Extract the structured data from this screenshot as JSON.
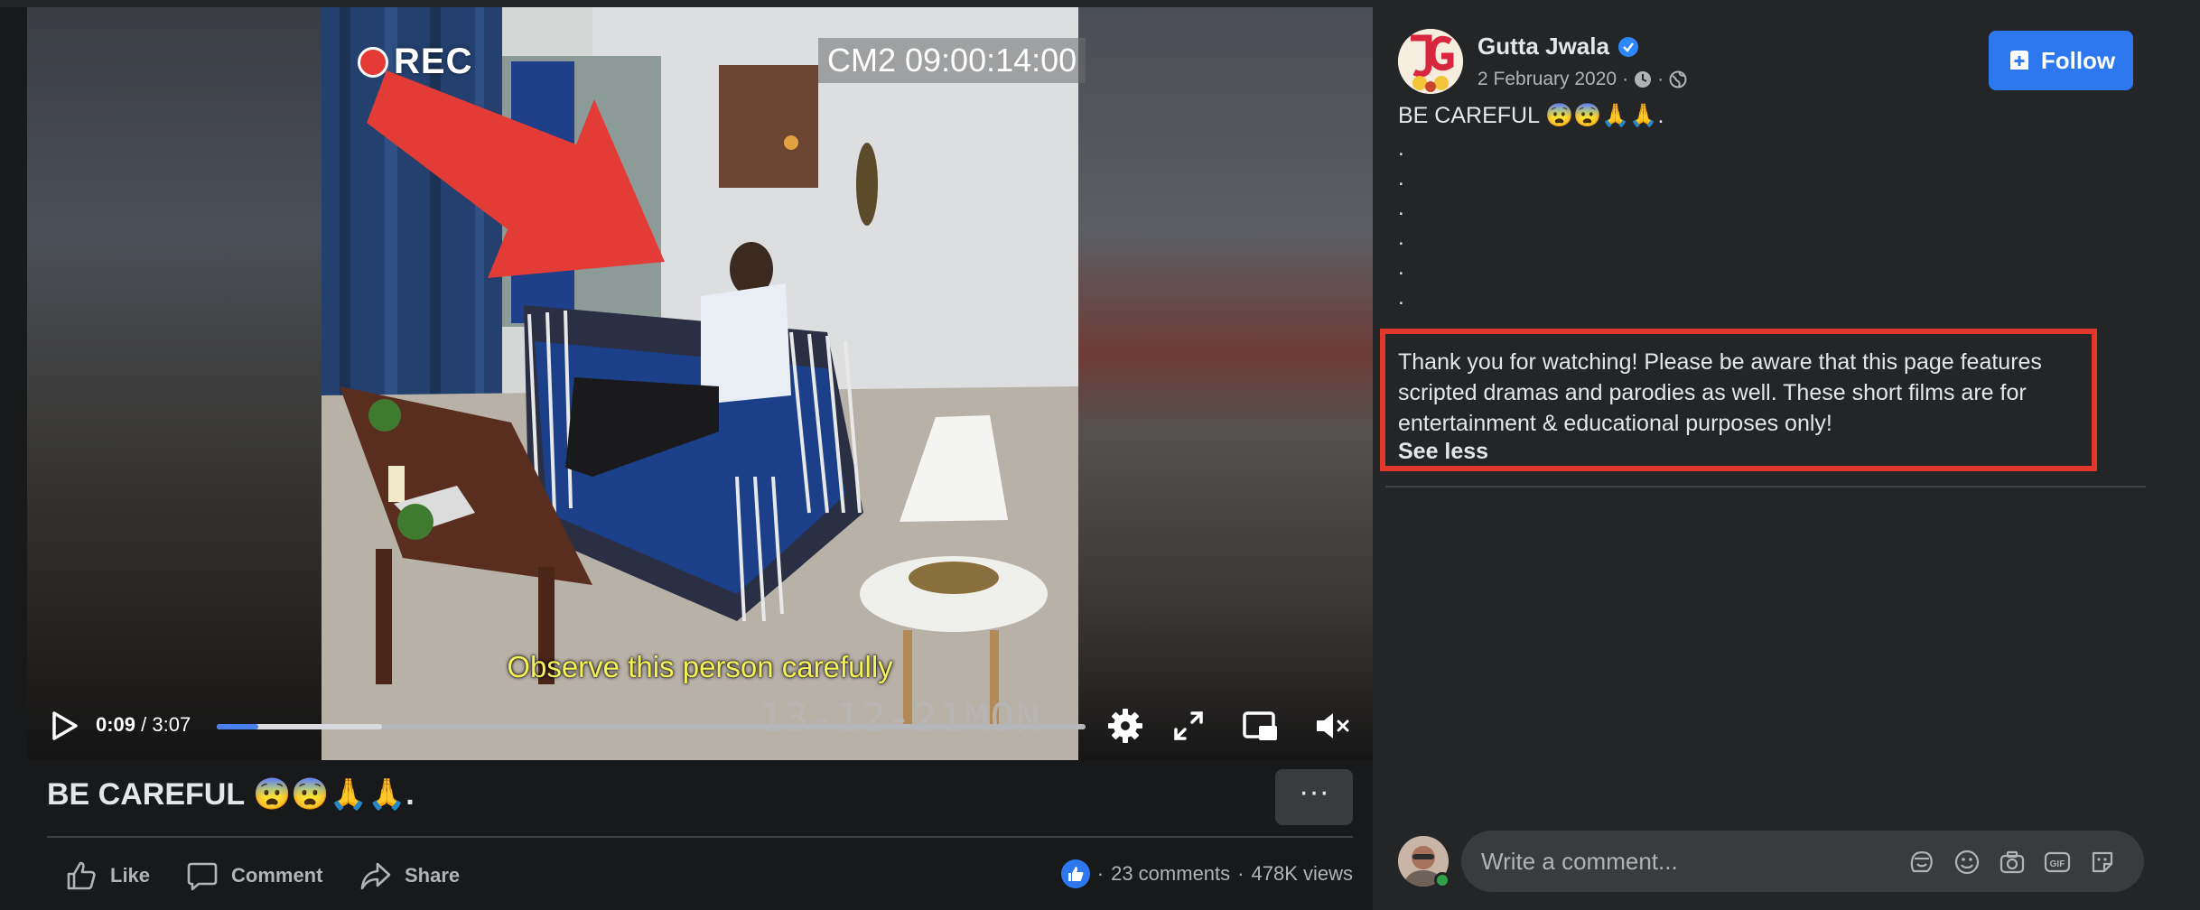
{
  "video": {
    "rec_label": "REC",
    "camera_stamp": "CM2 09:00:14:00",
    "subtitle": "Observe this person carefully",
    "date_stamp": "13-12-21MON",
    "current_time": "0:09",
    "duration": "3:07",
    "time_separator": "/",
    "progress_fraction": 0.048,
    "buffered_fraction": 0.19
  },
  "post": {
    "title": "BE CAREFUL 😨😨🙏🙏.",
    "more_label": "···",
    "actions": {
      "like": "Like",
      "comment": "Comment",
      "share": "Share"
    },
    "stats": {
      "comments": "23 comments",
      "views": "478K views",
      "sep": "·"
    }
  },
  "author": {
    "name": "Gutta Jwala",
    "date": "2 February 2020",
    "follow_label": "Follow",
    "meta_sep": "·"
  },
  "description": {
    "caption": "BE CAREFUL 😨😨🙏🙏.",
    "dots": [
      ".",
      ".",
      ".",
      ".",
      ".",
      "."
    ],
    "notice": "Thank you for watching! Please be aware that this page features scripted dramas and parodies as well. These short films are for entertainment & educational purposes only!",
    "see_less": "See less"
  },
  "comment": {
    "placeholder": "Write a comment..."
  },
  "colors": {
    "accent": "#2d78ef",
    "highlight_border": "#e1382b",
    "panel_bg": "#242526",
    "page_bg": "#18191a"
  },
  "icons": [
    "play-icon",
    "settings-icon",
    "fullscreen-icon",
    "pip-icon",
    "mute-icon",
    "thumb-up-icon",
    "comment-icon",
    "share-icon",
    "verified-icon",
    "clock-icon",
    "globe-icon",
    "follow-page-icon",
    "avatar-sticker-icon",
    "emoji-icon",
    "camera-icon",
    "gif-icon",
    "sticker-icon"
  ]
}
